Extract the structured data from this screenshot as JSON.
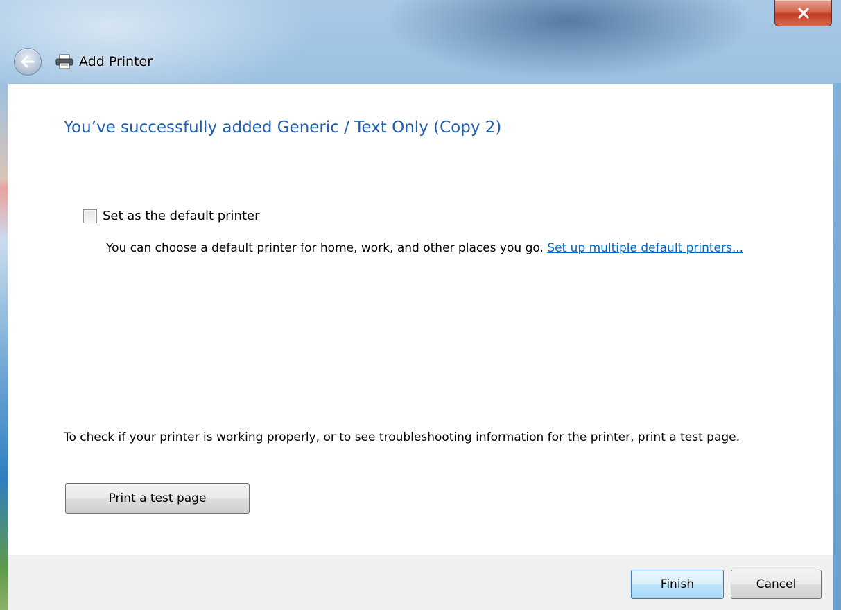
{
  "window": {
    "title": "Add Printer",
    "icons": {
      "back": "back-arrow-icon",
      "app": "printer-icon",
      "close": "close-icon"
    }
  },
  "main": {
    "heading": "You’ve successfully added Generic / Text Only (Copy 2)",
    "default_checkbox": {
      "label": "Set as the default printer",
      "checked": false
    },
    "help_text": "You can choose a default printer for home, work, and other places you go.",
    "help_link": "Set up multiple default printers...",
    "test_text": "To check if your printer is working properly, or to see troubleshooting information for the printer, print a test page.",
    "test_button": "Print a test page"
  },
  "footer": {
    "finish_label": "Finish",
    "cancel_label": "Cancel"
  },
  "colors": {
    "heading": "#1e5fb4",
    "link": "#0066cc",
    "close_button": "#c23b24"
  }
}
